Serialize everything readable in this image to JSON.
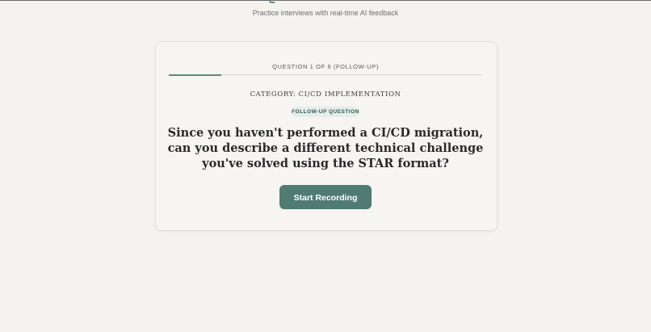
{
  "header": {
    "subtitle": "Practice interviews with real-time AI feedback"
  },
  "interview": {
    "progress_label": "QUESTION 1 OF 6 (FOLLOW-UP)",
    "progress_fraction": 0.1667,
    "category": "CATEGORY: CI/CD IMPLEMENTATION",
    "badge": "FOLLOW-UP QUESTION",
    "question": "Since you haven't performed a CI/CD migration, can you describe a different technical challenge you've solved using the STAR format?",
    "record_button": "Start Recording"
  },
  "colors": {
    "accent": "#4f7b73",
    "background": "#f4f3ef",
    "badge_bg": "#e6ece8"
  }
}
